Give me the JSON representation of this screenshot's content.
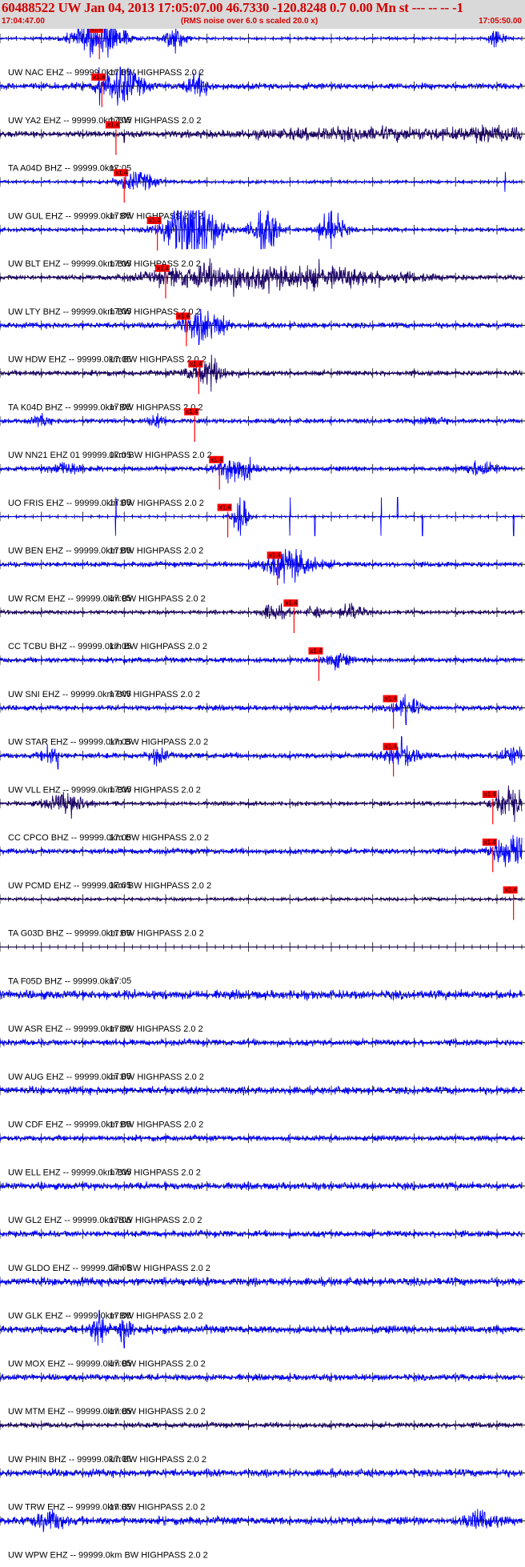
{
  "header": {
    "title": "60488522 UW Jan 04, 2013 17:05:07.00   46.7330 -120.8248  0.7 0.00 Mn st --- -- --   -1",
    "start_time": "17:04:47.00",
    "subtitle": "(RMS noise over 6.0 s scaled 20.0 x)",
    "end_time": "17:05:50.00"
  },
  "colors": {
    "header_bg": "#d9d9d9",
    "header_text": "#d40000",
    "trace_blue": "#0000ff",
    "trace_dark": "#1a0066",
    "pick": "#ff0000"
  },
  "time_marker_label": "17:05",
  "pick_label": "x1.4",
  "chart_data": {
    "type": "seismogram",
    "x_start": "17:04:47.00",
    "x_end": "17:05:50.00",
    "channels": [
      {
        "label": "UW NAC EHZ -- 99999.0km BW  HIGHPASS  2.0  2",
        "color": "blue",
        "pick_time_s": 12.0,
        "bursts": [
          [
            12,
            3,
            1.6
          ],
          [
            21,
            1.5,
            0.8
          ],
          [
            60,
            1,
            0.8
          ]
        ],
        "noise": 0.1,
        "spikes": [
          [
            13.5,
            1.2
          ],
          [
            21.2,
            0.9
          ]
        ]
      },
      {
        "label": "UW YA2 EHZ -- 99999.0km BW  HIGHPASS  2.0  2",
        "color": "blue",
        "pick_time_s": 12.3,
        "bursts": [
          [
            14.5,
            2.5,
            1.4
          ],
          [
            24,
            1.5,
            0.8
          ]
        ],
        "noise": 0.25,
        "spikes": [
          [
            12,
            1.5
          ],
          [
            14.5,
            1.4
          ]
        ]
      },
      {
        "label": "TA A04D BHZ -- 99999.0km",
        "color": "dark",
        "pick_time_s": 14.0,
        "bursts": [
          [
            45,
            15,
            0.35
          ],
          [
            60,
            4,
            0.35
          ]
        ],
        "noise": 0.25,
        "spikes": [
          [
            15,
            0.5
          ]
        ]
      },
      {
        "label": "UW GUL EHZ -- 99999.0km BW  HIGHPASS  2.0  2",
        "color": "blue",
        "pick_time_s": 15.0,
        "bursts": [
          [
            16.5,
            2.5,
            0.7
          ]
        ],
        "noise": 0.12,
        "spikes": [
          [
            61,
            0.6
          ]
        ]
      },
      {
        "label": "UW BLT EHZ -- 99999.0km BW  HIGHPASS  2.0  2",
        "color": "blue",
        "pick_time_s": 19.0,
        "bursts": [
          [
            23,
            3,
            3.0
          ],
          [
            32,
            1.5,
            2.2
          ],
          [
            40,
            1.5,
            1.5
          ]
        ],
        "noise": 0.15,
        "spikes": [
          [
            24,
            2
          ],
          [
            31.5,
            2
          ],
          [
            40,
            1.6
          ]
        ]
      },
      {
        "label": "UW LTY BHZ -- 99999.0km BW  HIGHPASS  2.0  2",
        "color": "dark",
        "pick_time_s": 20.0,
        "bursts": [
          [
            36,
            12,
            0.85
          ],
          [
            24,
            6,
            0.6
          ]
        ],
        "noise": 0.18,
        "spikes": []
      },
      {
        "label": "UW HDW EHZ -- 99999.0km BW  HIGHPASS  2.0  2",
        "color": "blue",
        "pick_time_s": 22.5,
        "bursts": [
          [
            24.5,
            2.5,
            1.1
          ]
        ],
        "noise": 0.22,
        "spikes": [
          [
            24,
            1.2
          ],
          [
            27,
            0.6
          ]
        ]
      },
      {
        "label": "TA K04D BHZ -- 99999.0km BW  HIGHPASS  2.0  2",
        "color": "dark",
        "pick_time_s": 24.0,
        "bursts": [
          [
            25,
            2.5,
            0.8
          ]
        ],
        "noise": 0.2,
        "spikes": [
          [
            25.5,
            1.1
          ]
        ]
      },
      {
        "label": "UW NN21 EHZ 01 99999.0km BW  HIGHPASS  2.0  2",
        "color": "blue",
        "pick_time_s": 23.5,
        "bursts": [
          [
            5,
            1,
            0.4
          ],
          [
            19,
            1,
            0.4
          ],
          [
            52,
            1.5,
            0.4
          ]
        ],
        "noise": 0.18,
        "spikes": []
      },
      {
        "label": "UO FRIS EHZ -- 99999.0km BW  HIGHPASS  2.0  2",
        "color": "blue",
        "pick_time_s": 26.5,
        "bursts": [
          [
            28.5,
            2,
            1.2
          ],
          [
            8,
            2,
            0.5
          ],
          [
            58,
            2,
            0.5
          ]
        ],
        "noise": 0.18,
        "spikes": []
      },
      {
        "label": "UW BEN EHZ -- 99999.0km BW  HIGHPASS  2.0  2",
        "color": "blue",
        "pick_time_s": 27.5,
        "bursts": [
          [
            29,
            1,
            1.5
          ]
        ],
        "noise": 0.06,
        "spikes": [
          [
            14,
            2
          ],
          [
            29,
            2
          ],
          [
            35,
            2
          ],
          [
            38,
            1.5
          ],
          [
            46,
            2
          ],
          [
            48,
            2
          ],
          [
            51,
            2
          ],
          [
            62,
            1.6
          ]
        ]
      },
      {
        "label": "UW RCM EHZ -- 99999.0km BW  HIGHPASS  2.0  2",
        "color": "blue",
        "pick_time_s": 33.5,
        "bursts": [
          [
            35,
            3,
            1.3
          ]
        ],
        "noise": 0.2,
        "spikes": []
      },
      {
        "label": "CC TCBU BHZ -- 99999.0km BW  HIGHPASS  2.0  2",
        "color": "dark",
        "pick_time_s": 35.5,
        "bursts": [
          [
            33,
            1.5,
            0.6
          ],
          [
            42.5,
            1.5,
            0.7
          ],
          [
            38,
            1,
            0.4
          ]
        ],
        "noise": 0.15,
        "spikes": []
      },
      {
        "label": "UW SNI EHZ -- 99999.0km BW  HIGHPASS  2.0  2",
        "color": "blue",
        "pick_time_s": 38.5,
        "bursts": [
          [
            40.5,
            1.5,
            0.6
          ]
        ],
        "noise": 0.2,
        "spikes": []
      },
      {
        "label": "UW STAR EHZ -- 99999.0km BW  HIGHPASS  2.0  2",
        "color": "blue",
        "pick_time_s": 47.5,
        "bursts": [
          [
            49,
            1.5,
            0.9
          ]
        ],
        "noise": 0.2,
        "spikes": [
          [
            49,
            1
          ]
        ]
      },
      {
        "label": "UW VLL EHZ -- 99999.0km BW  HIGHPASS  2.0  2",
        "color": "blue",
        "pick_time_s": 47.5,
        "bursts": [
          [
            48.5,
            2,
            0.9
          ],
          [
            6,
            1,
            0.7
          ],
          [
            19,
            1,
            0.6
          ],
          [
            62,
            1.5,
            0.6
          ]
        ],
        "noise": 0.22,
        "spikes": [
          [
            48.5,
            1.2
          ],
          [
            7,
            0.8
          ]
        ]
      },
      {
        "label": "CC CPCO BHZ -- 99999.0km BW  HIGHPASS  2.0  2",
        "color": "dark",
        "pick_time_s": 59.5,
        "bursts": [
          [
            8,
            2.5,
            0.8
          ],
          [
            61.5,
            2,
            1.2
          ]
        ],
        "noise": 0.15,
        "spikes": []
      },
      {
        "label": "UW PCMD EHZ -- 99999.0km BW  HIGHPASS  2.0  2",
        "color": "blue",
        "pick_time_s": 59.5,
        "bursts": [
          [
            62,
            2.5,
            1.4
          ]
        ],
        "noise": 0.22,
        "spikes": []
      },
      {
        "label": "TA G03D BHZ -- 99999.0km BW  HIGHPASS  2.0  2",
        "color": "dark",
        "pick_time_s": 62.0,
        "bursts": [],
        "noise": 0.12,
        "spikes": []
      },
      {
        "label": "TA F05D BHZ -- 99999.0km",
        "color": "dark",
        "pick_time_s": null,
        "bursts": [],
        "noise": 0.0,
        "spikes": []
      },
      {
        "label": "UW ASR EHZ -- 99999.0km BW  HIGHPASS  2.0  2",
        "color": "blue",
        "pick_time_s": null,
        "bursts": [],
        "noise": 0.35,
        "spikes": []
      },
      {
        "label": "UW AUG EHZ -- 99999.0km BW  HIGHPASS  2.0  2",
        "color": "blue",
        "pick_time_s": null,
        "bursts": [],
        "noise": 0.25,
        "spikes": []
      },
      {
        "label": "UW CDF EHZ -- 99999.0km BW  HIGHPASS  2.0  2",
        "color": "blue",
        "pick_time_s": null,
        "bursts": [],
        "noise": 0.3,
        "spikes": []
      },
      {
        "label": "UW ELL EHZ -- 99999.0km BW  HIGHPASS  2.0  2",
        "color": "blue",
        "pick_time_s": null,
        "bursts": [],
        "noise": 0.22,
        "spikes": []
      },
      {
        "label": "UW GL2 EHZ -- 99999.0km BW  HIGHPASS  2.0  2",
        "color": "blue",
        "pick_time_s": null,
        "bursts": [],
        "noise": 0.28,
        "spikes": []
      },
      {
        "label": "UW GLDO EHZ -- 99999.0km BW  HIGHPASS  2.0  2",
        "color": "blue",
        "pick_time_s": null,
        "bursts": [],
        "noise": 0.25,
        "spikes": []
      },
      {
        "label": "UW GLK EHZ -- 99999.0km BW  HIGHPASS  2.0  2",
        "color": "blue",
        "pick_time_s": null,
        "bursts": [],
        "noise": 0.32,
        "spikes": []
      },
      {
        "label": "UW MOX EHZ -- 99999.0km BW  HIGHPASS  2.0  2",
        "color": "blue",
        "pick_time_s": null,
        "bursts": [
          [
            12,
            1,
            1.0
          ],
          [
            15,
            1,
            1.0
          ]
        ],
        "noise": 0.3,
        "spikes": [
          [
            12,
            1.2
          ],
          [
            15,
            1.1
          ]
        ]
      },
      {
        "label": "UW MTM EHZ -- 99999.0km BW  HIGHPASS  2.0  2",
        "color": "blue",
        "pick_time_s": null,
        "bursts": [],
        "noise": 0.25,
        "spikes": []
      },
      {
        "label": "UW PHIN BHZ -- 99999.0km BW  HIGHPASS  2.0  2",
        "color": "dark",
        "pick_time_s": null,
        "bursts": [],
        "noise": 0.2,
        "spikes": []
      },
      {
        "label": "UW TRW EHZ -- 99999.0km BW  HIGHPASS  2.0  2",
        "color": "blue",
        "pick_time_s": null,
        "bursts": [],
        "noise": 0.3,
        "spikes": []
      },
      {
        "label": "UW WPW EHZ -- 99999.0km BW  HIGHPASS  2.0  2",
        "color": "blue",
        "pick_time_s": null,
        "bursts": [
          [
            6,
            2,
            0.7
          ],
          [
            58,
            2,
            0.7
          ]
        ],
        "noise": 0.3,
        "spikes": []
      }
    ]
  }
}
